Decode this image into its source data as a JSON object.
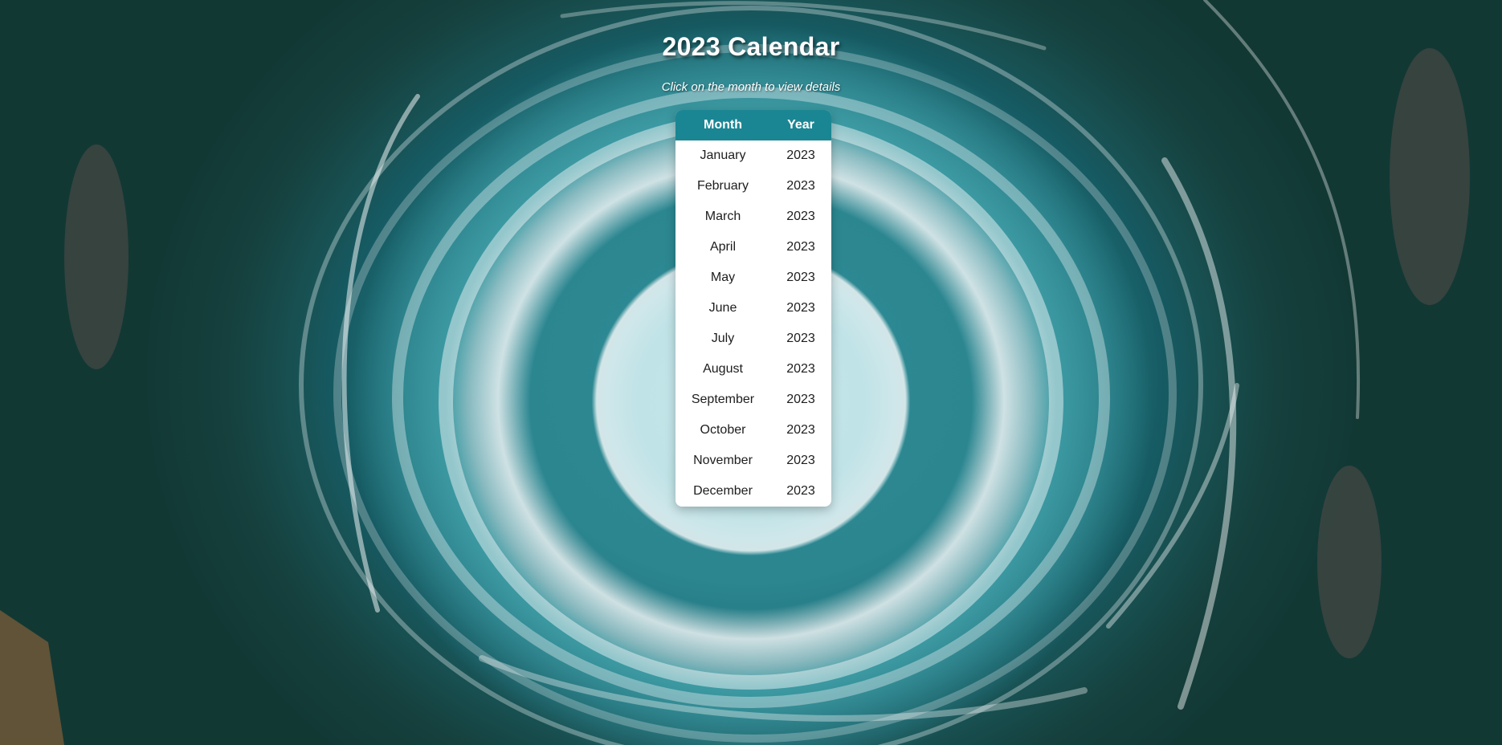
{
  "page": {
    "title": "2023 Calendar",
    "subtitle": "Click on the month to view details"
  },
  "table": {
    "headers": {
      "month": "Month",
      "year": "Year"
    },
    "rows": [
      {
        "month": "January",
        "year": "2023"
      },
      {
        "month": "February",
        "year": "2023"
      },
      {
        "month": "March",
        "year": "2023"
      },
      {
        "month": "April",
        "year": "2023"
      },
      {
        "month": "May",
        "year": "2023"
      },
      {
        "month": "June",
        "year": "2023"
      },
      {
        "month": "July",
        "year": "2023"
      },
      {
        "month": "August",
        "year": "2023"
      },
      {
        "month": "September",
        "year": "2023"
      },
      {
        "month": "October",
        "year": "2023"
      },
      {
        "month": "November",
        "year": "2023"
      },
      {
        "month": "December",
        "year": "2023"
      }
    ]
  },
  "colors": {
    "header_accent": "#1b8693",
    "card_background": "#ffffff",
    "title_text": "#ffffff"
  }
}
